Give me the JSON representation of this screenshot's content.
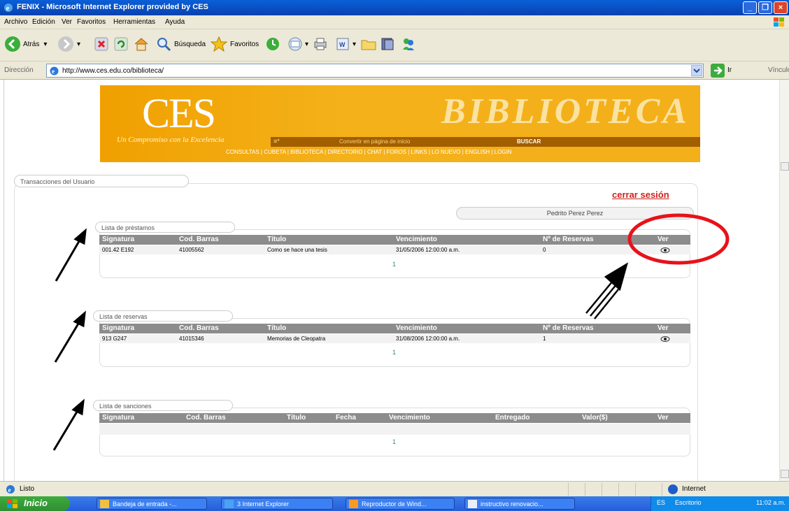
{
  "window": {
    "title": "FENIX - Microsoft Internet Explorer provided by CES",
    "minimize": "_",
    "maximize": "❐",
    "close": "×"
  },
  "menu": [
    "Archivo",
    "Edición",
    "Ver",
    "Favoritos",
    "Herramientas",
    "Ayuda"
  ],
  "toolbar": {
    "back": "Atrás",
    "search": "Búsqueda",
    "favorites": "Favoritos"
  },
  "address": {
    "label": "Dirección",
    "url": "http://www.ces.edu.co/biblioteca/",
    "go": "Ir",
    "links": "Vínculos"
  },
  "banner": {
    "logo": "CES",
    "slogan": "Un Compromiso con la Excelencia",
    "title": "BIBLIOTECA",
    "search_icon": "≡*",
    "search_placeholder": "Convertir en página de inicio",
    "search_button": "BUSCAR",
    "nav": "CONSULTAS | CUBETA | BIBLIOTECA | DIRECTORIO | CHAT | FOROS | LINKS | LO NUEVO | ENGLISH | LOGIN"
  },
  "page": {
    "section_title": "Transacciones del Usuario",
    "logout": "cerrar sesión",
    "user_name": "Pedrito Perez Perez"
  },
  "loans": {
    "legend": "Lista de préstamos",
    "headers": [
      "Signatura",
      "Cod. Barras",
      "Título",
      "Vencimiento",
      "Nº de Reservas",
      "Ver"
    ],
    "rows": [
      [
        "001.42 E192",
        "41005562",
        "Como se hace una tesis",
        "31/05/2006 12:00:00 a.m.",
        "0"
      ]
    ],
    "pager": "1"
  },
  "reservations": {
    "legend": "Lista de reservas",
    "headers": [
      "Signatura",
      "Cod. Barras",
      "Título",
      "Vencimiento",
      "Nº de Reservas",
      "Ver"
    ],
    "rows": [
      [
        "913 G247",
        "41015346",
        "Memorias de Cleopatra",
        "31/08/2006 12:00:00 a.m.",
        "1"
      ]
    ],
    "pager": "1"
  },
  "sanctions": {
    "legend": "Lista de sanciones",
    "headers": [
      "Signatura",
      "Cod. Barras",
      "Título",
      "Fecha",
      "Vencimiento",
      "Entregado",
      "Valor($)",
      "Ver"
    ],
    "rows": [],
    "pager": "1"
  },
  "status": {
    "ready": "Listo",
    "zone": "Internet"
  },
  "taskbar": {
    "start": "Inicio",
    "tasks": [
      "Bandeja de entrada -...",
      "3 Internet Explorer",
      "Reproductor de Wind...",
      "instructivo renovacio..."
    ],
    "lang": "ES",
    "desktop": "Escritorio",
    "time": "11:02 a.m."
  },
  "colors": {
    "banner": "#f3b01a",
    "header_row": "#8c8c8c",
    "logout": "#d0211b",
    "highlight": "#e8121a"
  }
}
